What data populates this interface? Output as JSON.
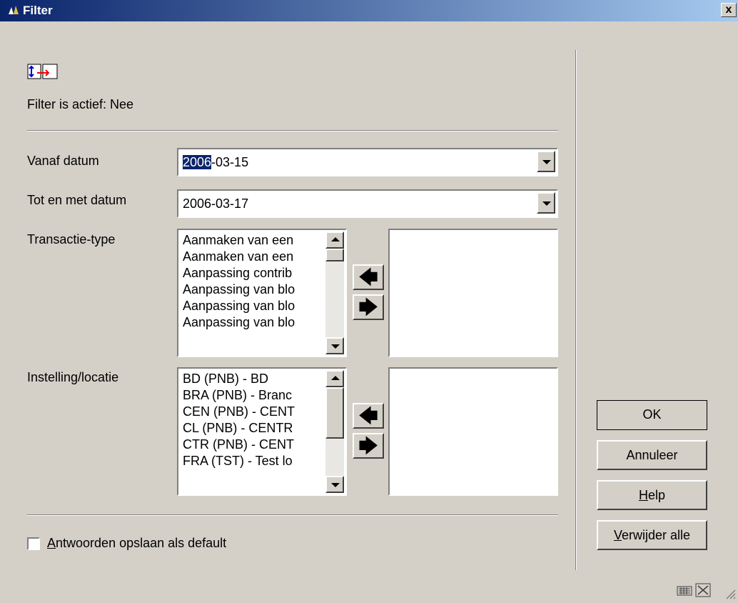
{
  "window": {
    "title": "Filter",
    "close": "x"
  },
  "status": {
    "text": "Filter is actief: Nee"
  },
  "form": {
    "from_label": "Vanaf datum",
    "from_sel": "2006",
    "from_rest": "-03-15",
    "to_label": "Tot en met datum",
    "to_value": "2006-03-17",
    "type_label": "Transactie-type",
    "type_items": [
      "Aanmaken van een",
      "Aanmaken van een",
      "Aanpassing contrib",
      "Aanpassing van blo",
      "Aanpassing van blo",
      "Aanpassing van blo"
    ],
    "loc_label": "Instelling/locatie",
    "loc_items": [
      "BD (PNB) - BD",
      "BRA (PNB) - Branc",
      "CEN (PNB) - CENT",
      "CL (PNB) - CENTR",
      "CTR (PNB) - CENT",
      "FRA (TST) - Test lo"
    ],
    "save_default_pre": "",
    "save_default_u": "A",
    "save_default_post": "ntwoorden opslaan als default"
  },
  "buttons": {
    "ok": "OK",
    "cancel": "Annuleer",
    "help_u": "H",
    "help_rest": "elp",
    "clear_u": "V",
    "clear_rest": "erwijder alle"
  },
  "icons": {
    "arrow_left": "🡄",
    "arrow_right": "🡆"
  }
}
